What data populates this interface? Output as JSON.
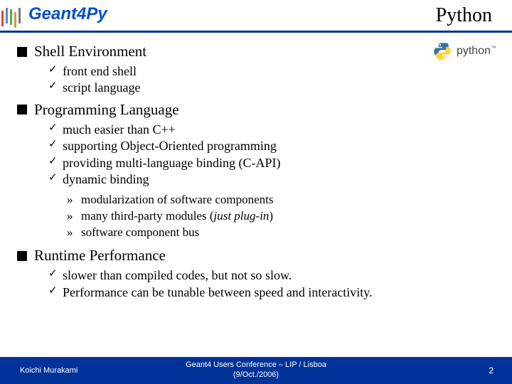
{
  "header": {
    "brand": "Geant4Py",
    "title": "Python"
  },
  "pylogo": {
    "text": "python",
    "tm": "™"
  },
  "sections": [
    {
      "title": "Shell Environment",
      "items": [
        {
          "text": "front end shell"
        },
        {
          "text": "script language"
        }
      ]
    },
    {
      "title": "Programming Language",
      "items": [
        {
          "text": "much easier than C++"
        },
        {
          "text": "supporting Object-Oriented programming"
        },
        {
          "text": "providing multi-language binding (C-API)"
        },
        {
          "text": "dynamic binding"
        }
      ],
      "subitems": [
        {
          "text": "modularization of software components"
        },
        {
          "text": "many third-party modules (",
          "italic": "just plug-in",
          "tail": ")"
        },
        {
          "text": "software component bus"
        }
      ]
    },
    {
      "title": "Runtime Performance",
      "items": [
        {
          "text": "slower than compiled codes, but not so slow."
        },
        {
          "text": "Performance can be tunable between speed and interactivity."
        }
      ]
    }
  ],
  "footer": {
    "author": "Koichi Murakami",
    "conf_line1": "Geant4 Users Conference – LIP / Lisboa",
    "conf_line2": "(9/Oct./2006)",
    "page": "2"
  }
}
